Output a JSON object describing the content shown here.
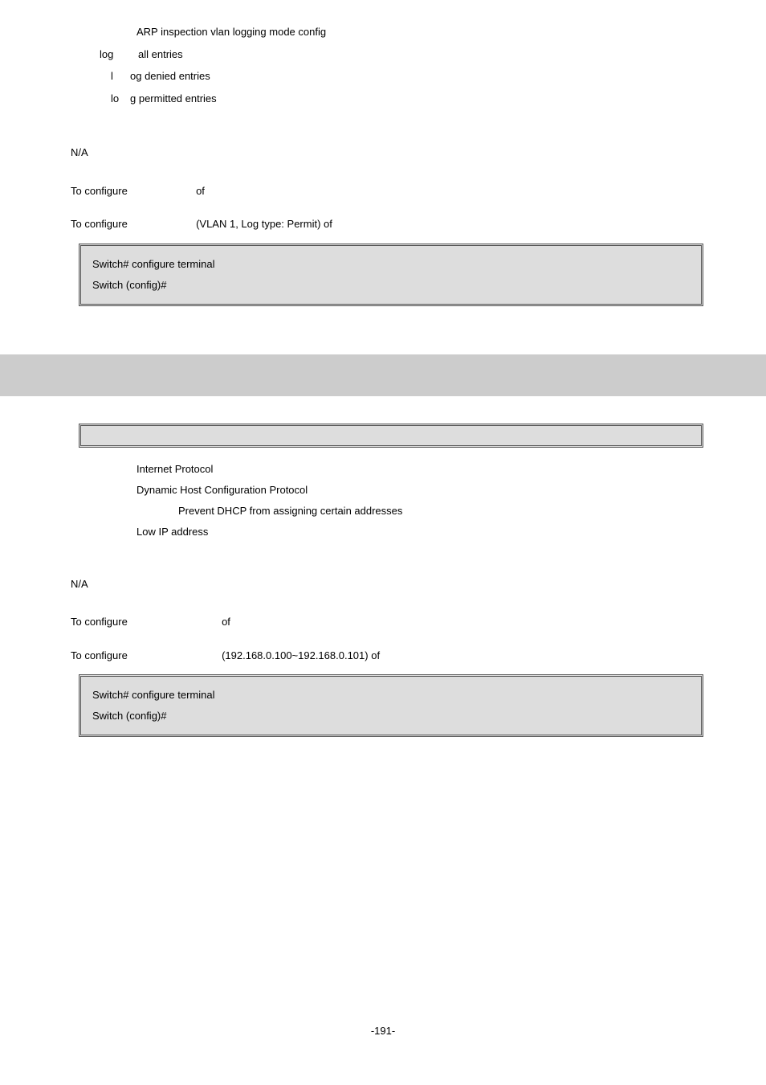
{
  "top": {
    "param1_desc": "ARP inspection vlan logging mode config",
    "sub1_label": "log",
    "sub1_desc": "all entries",
    "sub2_label": "l",
    "sub2_desc": "og denied entries",
    "sub3_label": "lo",
    "sub3_desc": "g permitted entries",
    "na": "N/A",
    "usage1_pre": "To configure",
    "usage1_mid": "of",
    "usage2_pre": "To configure",
    "usage2_mid": "(VLAN 1, Log type: Permit) of",
    "code1": "Switch# configure terminal",
    "code2": "Switch (config)#"
  },
  "bottom": {
    "p1": "Internet Protocol",
    "p2": "Dynamic Host Configuration Protocol",
    "p3": "Prevent DHCP from assigning certain addresses",
    "p4": "Low IP address",
    "na": "N/A",
    "usage1_pre": "To configure",
    "usage1_mid": "of",
    "usage2_pre": "To configure",
    "usage2_mid": "(192.168.0.100~192.168.0.101) of",
    "code1": "Switch# configure terminal",
    "code2": "Switch (config)#"
  },
  "footer": "-191-"
}
